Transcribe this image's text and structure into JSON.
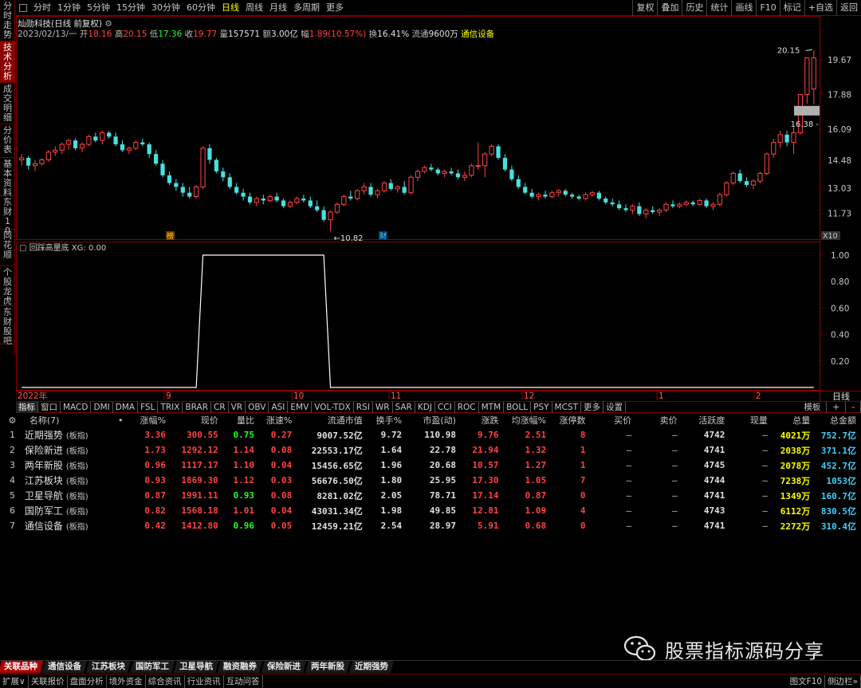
{
  "left_tabs": [
    {
      "label": "分时走势",
      "active": false
    },
    {
      "label": "技术分析",
      "active": true
    },
    {
      "label": "成交明细",
      "active": false
    },
    {
      "label": "分价表",
      "active": false
    },
    {
      "label": "基本资料",
      "active": false
    },
    {
      "label": "东财10",
      "active": false
    },
    {
      "label": "同花顺",
      "active": false
    },
    {
      "label": "个股龙虎",
      "active": false
    },
    {
      "label": "东财股吧",
      "active": false
    }
  ],
  "toolbar": {
    "periods": [
      "分时",
      "1分钟",
      "5分钟",
      "15分钟",
      "30分钟",
      "60分钟",
      "日线",
      "周线",
      "月线",
      "多周期",
      "更多"
    ],
    "active_period": "日线",
    "right_buttons": [
      "复权",
      "叠加",
      "历史",
      "统计",
      "画线",
      "F10",
      "标记",
      "+自选",
      "返回"
    ]
  },
  "stock": {
    "name": "灿勋科技(日线 前复权)",
    "date": "2023/02/13/一",
    "open_label": "开",
    "open": "18.16",
    "high_label": "高",
    "high": "20.15",
    "low_label": "低",
    "low": "17.36",
    "close_label": "收",
    "close": "19.77",
    "vol_label": "量",
    "vol": "157571",
    "amount_label": "额",
    "amount": "3.00亿",
    "change_label": "幅",
    "change": "1.89(10.57%)",
    "turnover_label": "换",
    "turnover": "16.41%",
    "float_label": "流通",
    "float": "9600万",
    "sector": "通信设备"
  },
  "price_axis": [
    "19.67",
    "17.88",
    "16.09",
    "14.48",
    "13.03",
    "11.73"
  ],
  "price_annotations": {
    "high": "20.15",
    "low": "10.82",
    "last": "16.38",
    "scale": "X10"
  },
  "markers": {
    "a": "榜",
    "b": "财"
  },
  "indicator": {
    "title": "回踩高量底 XG: 0.00",
    "axis": [
      "1.00",
      "0.80",
      "0.60",
      "0.40",
      "0.20"
    ]
  },
  "time_axis": [
    "2022年",
    "9",
    "10",
    "11",
    "12",
    "1",
    "2"
  ],
  "time_right": "日线",
  "chart_data": {
    "type": "candlestick",
    "title": "灿勋科技(日线 前复权)",
    "ylim": [
      10.4,
      20.7
    ],
    "candles": [
      [
        14.5,
        14.8,
        14.2,
        14.6
      ],
      [
        14.6,
        14.7,
        14.0,
        14.2
      ],
      [
        14.2,
        14.5,
        13.9,
        14.3
      ],
      [
        14.3,
        14.6,
        14.2,
        14.5
      ],
      [
        14.5,
        15.0,
        14.4,
        14.9
      ],
      [
        14.9,
        15.2,
        14.7,
        15.0
      ],
      [
        15.0,
        15.4,
        14.8,
        15.3
      ],
      [
        15.3,
        15.6,
        15.0,
        15.5
      ],
      [
        15.5,
        15.6,
        15.0,
        15.1
      ],
      [
        15.1,
        15.4,
        14.9,
        15.3
      ],
      [
        15.3,
        15.8,
        15.2,
        15.7
      ],
      [
        15.7,
        15.9,
        15.4,
        15.5
      ],
      [
        15.5,
        16.0,
        15.3,
        15.9
      ],
      [
        15.9,
        16.0,
        15.6,
        15.7
      ],
      [
        15.7,
        15.9,
        15.2,
        15.3
      ],
      [
        15.3,
        15.5,
        14.9,
        15.0
      ],
      [
        15.0,
        15.2,
        14.8,
        15.1
      ],
      [
        15.1,
        15.5,
        15.0,
        15.4
      ],
      [
        15.4,
        15.6,
        15.2,
        15.3
      ],
      [
        15.3,
        15.4,
        14.6,
        14.8
      ],
      [
        14.8,
        15.0,
        14.2,
        14.3
      ],
      [
        14.3,
        14.5,
        13.6,
        13.7
      ],
      [
        13.7,
        13.9,
        13.2,
        13.3
      ],
      [
        13.3,
        13.5,
        12.9,
        13.1
      ],
      [
        13.1,
        13.3,
        12.6,
        12.8
      ],
      [
        12.8,
        13.1,
        12.5,
        12.6
      ],
      [
        12.6,
        13.2,
        12.5,
        13.1
      ],
      [
        13.1,
        15.2,
        13.0,
        15.1
      ],
      [
        15.1,
        15.3,
        14.3,
        14.5
      ],
      [
        14.5,
        14.6,
        13.8,
        13.9
      ],
      [
        13.9,
        14.1,
        13.4,
        13.6
      ],
      [
        13.6,
        13.8,
        13.0,
        13.1
      ],
      [
        13.1,
        13.3,
        12.7,
        12.8
      ],
      [
        12.8,
        13.0,
        12.4,
        12.6
      ],
      [
        12.6,
        12.8,
        12.2,
        12.3
      ],
      [
        12.3,
        12.6,
        12.1,
        12.5
      ],
      [
        12.5,
        12.7,
        12.2,
        12.4
      ],
      [
        12.4,
        12.7,
        12.3,
        12.6
      ],
      [
        12.6,
        12.8,
        12.3,
        12.4
      ],
      [
        12.4,
        12.5,
        12.0,
        12.1
      ],
      [
        12.1,
        12.4,
        12.0,
        12.3
      ],
      [
        12.3,
        12.6,
        12.2,
        12.5
      ],
      [
        12.5,
        12.7,
        12.3,
        12.4
      ],
      [
        12.4,
        12.6,
        12.0,
        12.1
      ],
      [
        12.1,
        12.4,
        11.8,
        11.9
      ],
      [
        11.9,
        12.1,
        11.3,
        11.4
      ],
      [
        11.4,
        11.9,
        10.82,
        11.8
      ],
      [
        11.8,
        12.3,
        11.7,
        12.2
      ],
      [
        12.2,
        12.7,
        12.1,
        12.6
      ],
      [
        12.6,
        12.9,
        12.4,
        12.5
      ],
      [
        12.5,
        13.0,
        12.4,
        12.9
      ],
      [
        12.9,
        13.3,
        12.7,
        13.1
      ],
      [
        13.1,
        13.3,
        12.6,
        12.7
      ],
      [
        12.7,
        13.0,
        12.5,
        12.9
      ],
      [
        12.9,
        13.4,
        12.8,
        13.3
      ],
      [
        13.3,
        13.5,
        12.9,
        13.0
      ],
      [
        13.0,
        13.2,
        12.8,
        13.1
      ],
      [
        13.1,
        13.4,
        12.7,
        12.8
      ],
      [
        12.8,
        13.7,
        12.7,
        13.6
      ],
      [
        13.6,
        14.0,
        13.4,
        13.9
      ],
      [
        13.9,
        14.2,
        13.8,
        14.1
      ],
      [
        14.1,
        14.3,
        13.9,
        14.0
      ],
      [
        14.0,
        14.1,
        13.7,
        13.8
      ],
      [
        13.8,
        14.0,
        13.6,
        13.9
      ],
      [
        13.9,
        14.1,
        13.7,
        13.8
      ],
      [
        13.8,
        14.0,
        13.5,
        13.6
      ],
      [
        13.6,
        13.9,
        13.4,
        13.7
      ],
      [
        13.7,
        14.3,
        13.6,
        14.2
      ],
      [
        14.2,
        15.4,
        14.0,
        14.2
      ],
      [
        14.2,
        14.9,
        13.6,
        14.8
      ],
      [
        14.8,
        15.3,
        14.7,
        15.2
      ],
      [
        15.2,
        15.3,
        14.5,
        14.6
      ],
      [
        14.6,
        14.8,
        13.9,
        14.0
      ],
      [
        14.0,
        14.2,
        13.4,
        13.5
      ],
      [
        13.5,
        13.7,
        13.0,
        13.1
      ],
      [
        13.1,
        13.3,
        12.7,
        12.8
      ],
      [
        12.8,
        13.0,
        12.5,
        12.6
      ],
      [
        12.6,
        12.8,
        12.4,
        12.7
      ],
      [
        12.7,
        12.9,
        12.5,
        12.6
      ],
      [
        12.6,
        12.9,
        12.5,
        12.8
      ],
      [
        12.8,
        13.0,
        12.6,
        12.9
      ],
      [
        12.9,
        13.0,
        12.6,
        12.7
      ],
      [
        12.7,
        12.8,
        12.5,
        12.6
      ],
      [
        12.6,
        12.7,
        12.4,
        12.5
      ],
      [
        12.5,
        12.8,
        12.4,
        12.7
      ],
      [
        12.7,
        12.9,
        12.6,
        12.8
      ],
      [
        12.8,
        12.9,
        12.4,
        12.5
      ],
      [
        12.5,
        12.6,
        12.2,
        12.3
      ],
      [
        12.3,
        12.5,
        12.1,
        12.2
      ],
      [
        12.2,
        12.4,
        11.9,
        12.0
      ],
      [
        12.0,
        12.2,
        11.8,
        11.9
      ],
      [
        11.9,
        12.2,
        11.7,
        12.1
      ],
      [
        12.1,
        12.3,
        11.6,
        11.7
      ],
      [
        11.7,
        12.0,
        11.5,
        11.9
      ],
      [
        11.9,
        12.1,
        11.7,
        11.8
      ],
      [
        11.8,
        12.0,
        11.6,
        11.9
      ],
      [
        11.9,
        12.3,
        11.8,
        12.2
      ],
      [
        12.2,
        12.4,
        12.0,
        12.1
      ],
      [
        12.1,
        12.3,
        12.0,
        12.2
      ],
      [
        12.2,
        12.4,
        12.1,
        12.3
      ],
      [
        12.3,
        12.4,
        12.1,
        12.2
      ],
      [
        12.2,
        12.5,
        12.1,
        12.4
      ],
      [
        12.4,
        12.5,
        12.0,
        12.1
      ],
      [
        12.1,
        12.3,
        11.9,
        12.2
      ],
      [
        12.2,
        12.8,
        12.1,
        12.7
      ],
      [
        12.7,
        13.4,
        12.6,
        13.3
      ],
      [
        13.3,
        13.9,
        13.2,
        13.8
      ],
      [
        13.8,
        14.0,
        13.3,
        13.4
      ],
      [
        13.4,
        13.6,
        13.1,
        13.2
      ],
      [
        13.2,
        13.5,
        13.0,
        13.4
      ],
      [
        13.4,
        13.9,
        13.3,
        13.8
      ],
      [
        13.8,
        14.9,
        13.7,
        14.8
      ],
      [
        14.8,
        15.6,
        14.6,
        15.4
      ],
      [
        15.4,
        16.0,
        15.1,
        15.8
      ],
      [
        15.8,
        16.0,
        15.2,
        15.4
      ],
      [
        15.4,
        16.2,
        14.8,
        15.9
      ],
      [
        15.9,
        17.9,
        15.8,
        17.88
      ],
      [
        17.88,
        19.8,
        17.4,
        19.77
      ],
      [
        18.16,
        20.15,
        17.36,
        19.77
      ]
    ],
    "indicator_values": [
      0,
      0,
      0,
      0,
      0,
      0,
      0,
      0,
      0,
      0,
      0,
      0,
      0,
      0,
      0,
      0,
      0,
      0,
      0,
      0,
      0,
      0,
      0,
      0,
      0,
      0,
      0,
      1,
      1,
      1,
      1,
      1,
      1,
      1,
      1,
      1,
      1,
      1,
      1,
      1,
      1,
      1,
      1,
      1,
      1,
      1,
      0,
      0,
      0,
      0,
      0,
      0,
      0,
      0,
      0,
      0,
      0,
      0,
      0,
      0,
      0,
      0,
      0,
      0,
      0,
      0,
      0,
      0,
      0,
      0,
      0,
      0,
      0,
      0,
      0,
      0,
      0,
      0,
      0,
      0,
      0,
      0,
      0,
      0,
      0,
      0,
      0,
      0,
      0,
      0,
      0,
      0,
      0,
      0,
      0,
      0,
      0,
      0,
      0,
      0,
      0,
      0,
      0,
      0,
      0,
      0,
      0,
      0,
      0,
      0,
      0,
      0,
      0,
      0,
      0,
      0,
      0,
      0
    ],
    "colors": {
      "up": "#ff4444",
      "down": "#48e0e0",
      "indicator": "#ffffff"
    }
  },
  "indicator_tabs": [
    "指标",
    "窗口",
    "MACD",
    "DMI",
    "DMA",
    "FSL",
    "TRIX",
    "BRAR",
    "CR",
    "VR",
    "OBV",
    "ASI",
    "EMV",
    "VOL-TDX",
    "RSI",
    "WR",
    "SAR",
    "KDJ",
    "CCI",
    "ROC",
    "MTM",
    "BOLL",
    "PSY",
    "MCST",
    "更多",
    "设置"
  ],
  "indicator_tabs_right": [
    "模板",
    "+",
    "-"
  ],
  "table": {
    "headers": [
      "",
      "名称(7)",
      "•",
      "涨幅%",
      "现价",
      "量比",
      "涨速%",
      "流通市值",
      "换手%",
      "市盈(动)",
      "涨跌",
      "均涨幅%",
      "涨停数",
      "买价",
      "卖价",
      "活跃度",
      "现量",
      "总量",
      "总金额"
    ],
    "rows": [
      {
        "idx": "1",
        "name": "近期强势",
        "tag": "(板指)",
        "chg": "3.36",
        "price": "300.55",
        "vr": "0.75",
        "spd": "0.27",
        "cap": "9007.52亿",
        "turn": "9.72",
        "pe": "110.98",
        "diff": "9.76",
        "avg": "2.51",
        "lim": "8",
        "buy": "—",
        "sell": "—",
        "act": "4742",
        "cur": "—",
        "vol": "4021万",
        "amt": "752.7亿"
      },
      {
        "idx": "2",
        "name": "保险新进",
        "tag": "(板指)",
        "chg": "1.73",
        "price": "1292.12",
        "vr": "1.14",
        "spd": "0.08",
        "cap": "22553.17亿",
        "turn": "1.64",
        "pe": "22.78",
        "diff": "21.94",
        "avg": "1.32",
        "lim": "1",
        "buy": "—",
        "sell": "—",
        "act": "4741",
        "cur": "—",
        "vol": "2038万",
        "amt": "371.1亿"
      },
      {
        "idx": "3",
        "name": "两年新股",
        "tag": "(板指)",
        "chg": "0.96",
        "price": "1117.17",
        "vr": "1.10",
        "spd": "0.04",
        "cap": "15456.65亿",
        "turn": "1.96",
        "pe": "20.68",
        "diff": "10.57",
        "avg": "1.27",
        "lim": "1",
        "buy": "—",
        "sell": "—",
        "act": "4745",
        "cur": "—",
        "vol": "2078万",
        "amt": "452.7亿"
      },
      {
        "idx": "4",
        "name": "江苏板块",
        "tag": "(板指)",
        "chg": "0.93",
        "price": "1869.30",
        "vr": "1.12",
        "spd": "0.03",
        "cap": "56676.50亿",
        "turn": "1.80",
        "pe": "25.95",
        "diff": "17.30",
        "avg": "1.05",
        "lim": "7",
        "buy": "—",
        "sell": "—",
        "act": "4744",
        "cur": "—",
        "vol": "7238万",
        "amt": "1053亿"
      },
      {
        "idx": "5",
        "name": "卫星导航",
        "tag": "(板指)",
        "chg": "0.87",
        "price": "1991.11",
        "vr": "0.93",
        "spd": "0.08",
        "cap": "8281.02亿",
        "turn": "2.05",
        "pe": "78.71",
        "diff": "17.14",
        "avg": "0.87",
        "lim": "0",
        "buy": "—",
        "sell": "—",
        "act": "4741",
        "cur": "—",
        "vol": "1349万",
        "amt": "160.7亿"
      },
      {
        "idx": "6",
        "name": "国防军工",
        "tag": "(板指)",
        "chg": "0.82",
        "price": "1568.18",
        "vr": "1.01",
        "spd": "0.04",
        "cap": "43031.34亿",
        "turn": "1.98",
        "pe": "49.85",
        "diff": "12.81",
        "avg": "1.09",
        "lim": "4",
        "buy": "—",
        "sell": "—",
        "act": "4743",
        "cur": "—",
        "vol": "6112万",
        "amt": "830.5亿"
      },
      {
        "idx": "7",
        "name": "通信设备",
        "tag": "(板指)",
        "chg": "0.42",
        "price": "1412.80",
        "vr": "0.96",
        "spd": "0.05",
        "cap": "12459.21亿",
        "turn": "2.54",
        "pe": "28.97",
        "diff": "5.91",
        "avg": "0.68",
        "lim": "0",
        "buy": "—",
        "sell": "—",
        "act": "4741",
        "cur": "—",
        "vol": "2272万",
        "amt": "310.4亿"
      }
    ]
  },
  "watermark": {
    "text": "股票指标源码分享"
  },
  "sector_tabs": [
    {
      "label": "关联品种",
      "active": true
    },
    {
      "label": "通信设备",
      "active": false
    },
    {
      "label": "江苏板块",
      "active": false
    },
    {
      "label": "国防军工",
      "active": false
    },
    {
      "label": "卫星导航",
      "active": false
    },
    {
      "label": "融资融券",
      "active": false
    },
    {
      "label": "保险新进",
      "active": false
    },
    {
      "label": "两年新股",
      "active": false
    },
    {
      "label": "近期强势",
      "active": false
    }
  ],
  "bottom_bar": [
    "扩展∨",
    "关联报价",
    "盘面分析",
    "境外资金",
    "综合资讯",
    "行业资讯",
    "互动问答"
  ],
  "bottom_right": [
    "图文F10",
    "侧边栏»"
  ]
}
